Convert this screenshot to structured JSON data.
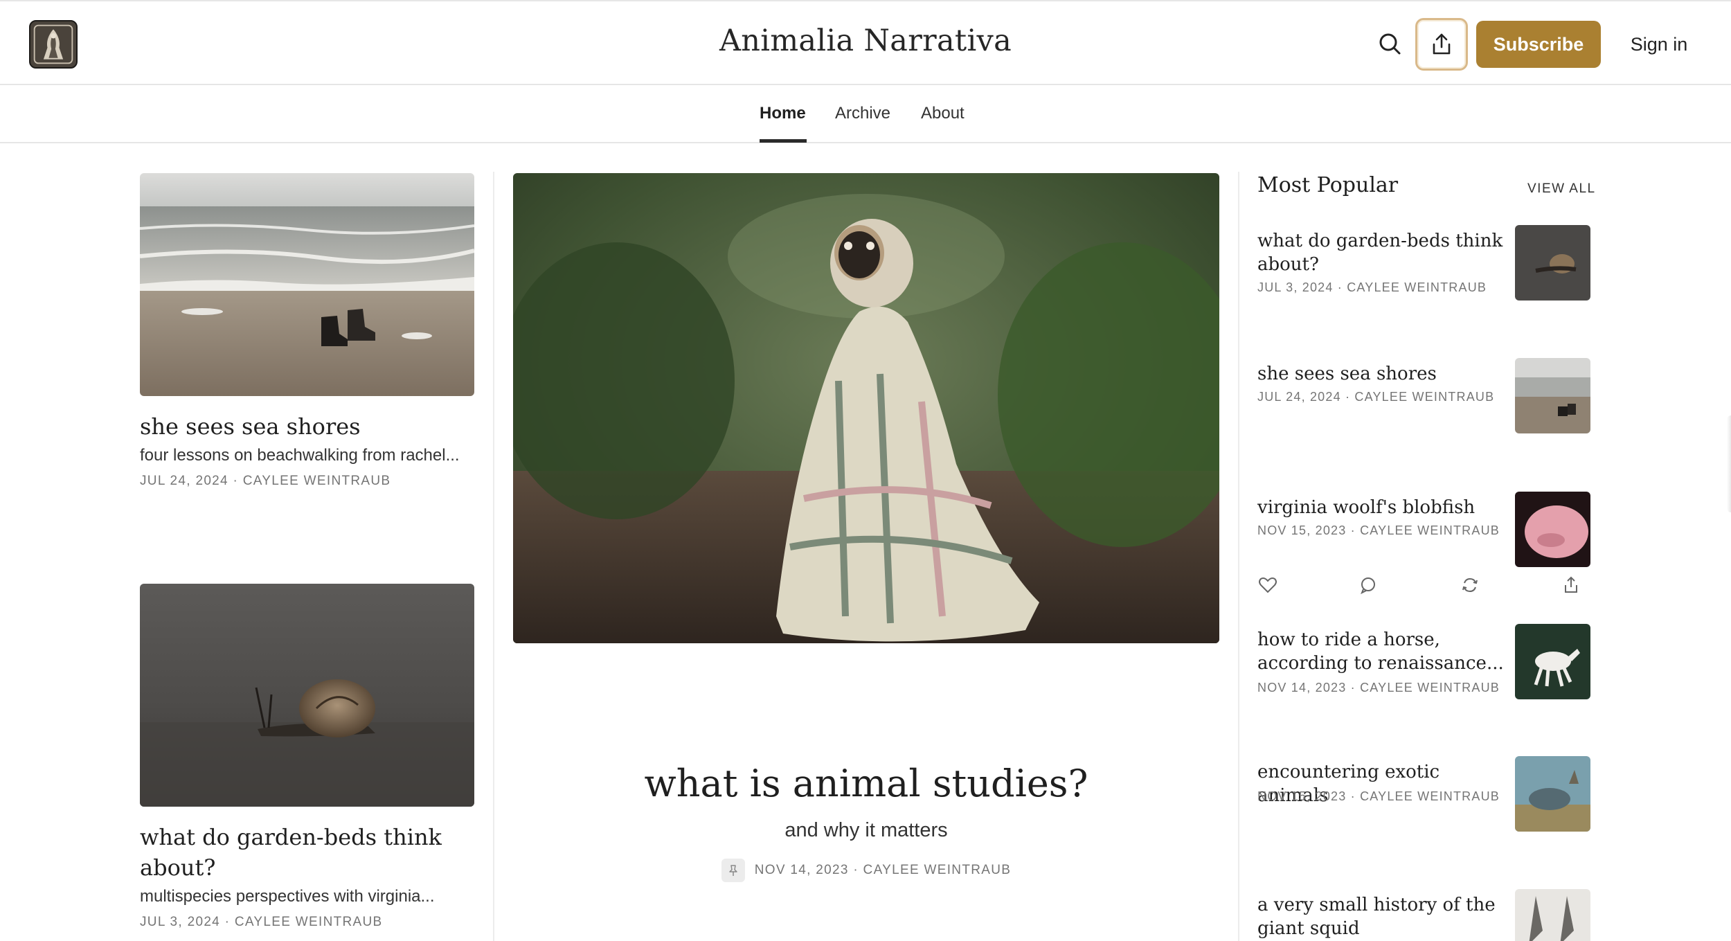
{
  "header": {
    "site_title": "Animalia Narrativa",
    "subscribe_label": "Subscribe",
    "signin_label": "Sign in",
    "icons": [
      "logo",
      "search-icon",
      "share-icon"
    ],
    "accent_color": "#aa8031"
  },
  "nav": {
    "items": [
      {
        "label": "Home",
        "active": true
      },
      {
        "label": "Archive",
        "active": false
      },
      {
        "label": "About",
        "active": false
      }
    ]
  },
  "left_posts": [
    {
      "title": "she sees sea shores",
      "subtitle": "four lessons on beachwalking from rachel...",
      "meta": "JUL 24, 2024 · CAYLEE WEINTRAUB"
    },
    {
      "title": "what do garden-beds think about?",
      "subtitle": "multispecies perspectives with virginia...",
      "meta": "JUL 3, 2024 · CAYLEE WEINTRAUB"
    }
  ],
  "featured": {
    "title": "what is animal studies?",
    "subtitle": "and why it matters",
    "meta": "NOV 14, 2023 · CAYLEE WEINTRAUB",
    "pinned": true
  },
  "popular": {
    "heading": "Most Popular",
    "view_all_label": "VIEW ALL",
    "items": [
      {
        "title": "what do garden-beds think about?",
        "meta": "JUL 3, 2024 · CAYLEE WEINTRAUB"
      },
      {
        "title": "she sees sea shores",
        "meta": "JUL 24, 2024 · CAYLEE WEINTRAUB"
      },
      {
        "title": "virginia woolf's blobfish",
        "meta": "NOV 15, 2023 · CAYLEE WEINTRAUB"
      },
      {
        "title": "how to ride a horse, according to renaissance...",
        "meta": "NOV 14, 2023 · CAYLEE WEINTRAUB"
      },
      {
        "title": "encountering exotic animals",
        "meta": "NOV 15, 2023 · CAYLEE WEINTRAUB"
      },
      {
        "title": "a very small history of the giant squid",
        "meta": ""
      }
    ],
    "action_icons": [
      "heart-icon",
      "comment-icon",
      "restack-icon",
      "share-icon"
    ]
  }
}
